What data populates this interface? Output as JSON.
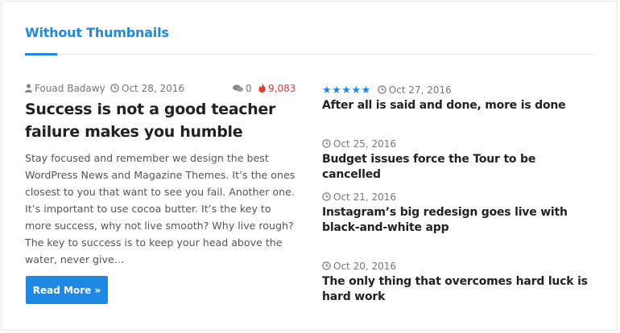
{
  "widget": {
    "title": "Without Thumbnails"
  },
  "featured": {
    "author": "Fouad Badawy",
    "date": "Oct 28, 2016",
    "comments": "0",
    "views": "9,083",
    "title": "Success is not a good teacher failure makes you humble",
    "excerpt": "Stay focused and remember we design the best WordPress News and Magazine Themes. It’s the ones closest to you that want to see you fail. Another one. It’s important to use cocoa butter. It’s the key to more success, why not live smooth? Why live rough? The key to success is to keep your head above the water, never give…",
    "read_more_label": "Read More »"
  },
  "side_posts": [
    {
      "rating": 5,
      "rating_stars": "★★★★★",
      "date": "Oct 27, 2016",
      "title": "After all is said and done, more is done"
    },
    {
      "date": "Oct 25, 2016",
      "title": "Budget issues force the Tour to be cancelled"
    },
    {
      "date": "Oct 21, 2016",
      "title": "Instagram’s big redesign goes live with black-and-white app"
    },
    {
      "date": "Oct 20, 2016",
      "title": "The only thing that overcomes hard luck is hard work"
    }
  ],
  "colors": {
    "accent": "#1e88e5",
    "views": "#e53935",
    "title": "#222222",
    "meta": "#777777"
  },
  "icons": [
    "user-icon",
    "clock-icon",
    "comment-icon",
    "fire-icon",
    "star-icon"
  ]
}
